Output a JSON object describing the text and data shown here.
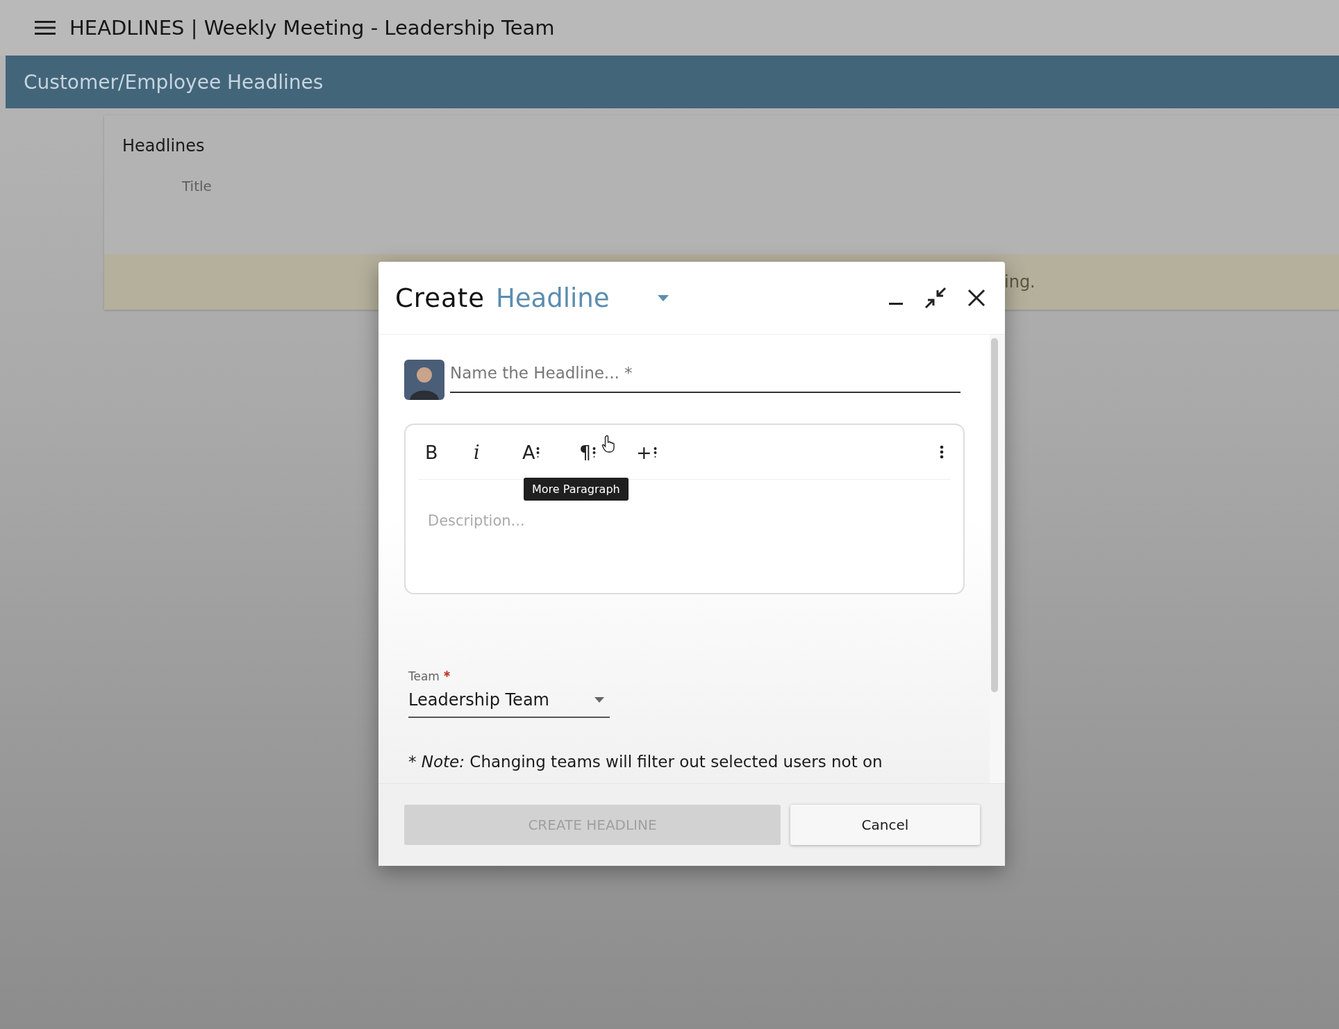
{
  "app_bar": {
    "title": "HEADLINES | Weekly Meeting - Leadership Team"
  },
  "section_header": {
    "title": "Customer/Employee Headlines"
  },
  "card": {
    "title": "Headlines",
    "column_1": "Title",
    "notice": "ing."
  },
  "dialog": {
    "title": "Create",
    "type_label": "Headline",
    "name_field": {
      "placeholder": "Name the Headline... *"
    },
    "toolbar": [
      {
        "kind": "bold",
        "label": "B"
      },
      {
        "kind": "italic",
        "label": "i"
      },
      {
        "kind": "menu",
        "label": "A"
      },
      {
        "kind": "menu",
        "label": "¶",
        "tooltip": "More Paragraph"
      },
      {
        "kind": "menu",
        "label": "+"
      },
      {
        "kind": "overflow"
      }
    ],
    "description": {
      "placeholder": "Description..."
    },
    "team": {
      "label": "Team",
      "required": true,
      "value": "Leadership Team"
    },
    "note": "* *Note:* Changing teams will filter out selected users not on",
    "buttons": [
      {
        "label": "CREATE HEADLINE",
        "disabled": true
      },
      {
        "label": "Cancel",
        "disabled": false
      }
    ]
  }
}
